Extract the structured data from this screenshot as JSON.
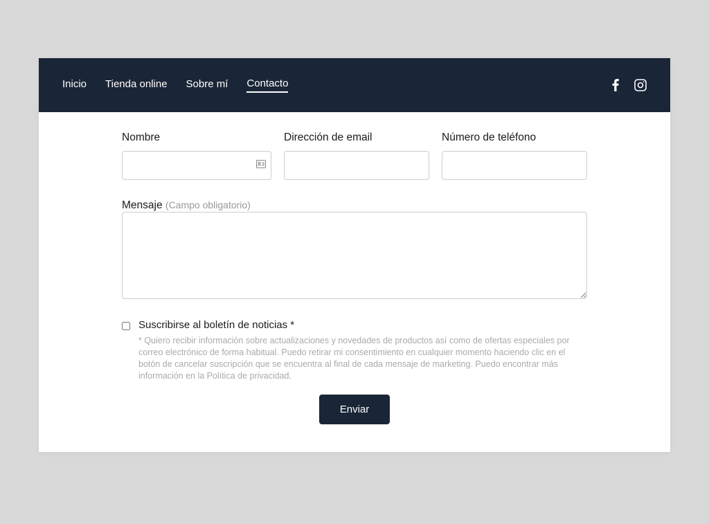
{
  "nav": {
    "items": [
      {
        "label": "Inicio",
        "active": false
      },
      {
        "label": "Tienda online",
        "active": false
      },
      {
        "label": "Sobre mí",
        "active": false
      },
      {
        "label": "Contacto",
        "active": true
      }
    ]
  },
  "form": {
    "name_label": "Nombre",
    "email_label": "Dirección de email",
    "phone_label": "Número de teléfono",
    "message_label": "Mensaje",
    "message_required_hint": "(Campo obligatorio)",
    "newsletter_label": "Suscribirse al boletín de noticias *",
    "consent_text": "* Quiero recibir información sobre actualizaciones y novedades de productos así como de ofertas especiales por correo electrónico de forma habitual. Puedo retirar mi consentimiento en cualquier momento haciendo clic en el botón de cancelar suscripción que se encuentra al final de cada mensaje de marketing. Puedo encontrar más información en la Política de privacidad.",
    "submit_label": "Enviar"
  }
}
